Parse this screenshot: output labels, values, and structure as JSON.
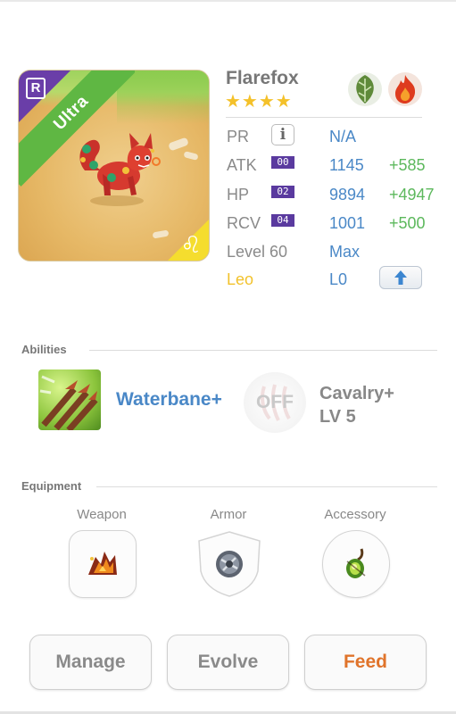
{
  "monster": {
    "name": "Flarefox",
    "stars": "★★★★",
    "rarity_letter": "R",
    "tier": "Ultra",
    "zodiac_glyph": "♌",
    "elements": [
      "leaf-element-icon",
      "fire-element-icon"
    ]
  },
  "stats": {
    "pr": {
      "label": "PR",
      "info": "i",
      "value": "N/A"
    },
    "atk": {
      "label": "ATK",
      "plus": "00",
      "value": "1145",
      "bonus": "+585"
    },
    "hp": {
      "label": "HP",
      "plus": "02",
      "value": "9894",
      "bonus": "+4947"
    },
    "rcv": {
      "label": "RCV",
      "plus": "04",
      "value": "1001",
      "bonus": "+500"
    },
    "level": {
      "label": "Level 60",
      "value": "Max"
    },
    "sign": {
      "label": "Leo",
      "value": "L0"
    }
  },
  "abilities": {
    "title": "Abilities",
    "skill_name": "Waterbane+",
    "leader_state": "OFF",
    "leader_name": "Cavalry+",
    "leader_level": "LV 5"
  },
  "equipment": {
    "title": "Equipment",
    "slots": [
      {
        "label": "Weapon",
        "icon": "weapon-icon"
      },
      {
        "label": "Armor",
        "icon": "armor-icon"
      },
      {
        "label": "Accessory",
        "icon": "accessory-icon"
      }
    ]
  },
  "actions": {
    "manage": "Manage",
    "evolve": "Evolve",
    "feed": "Feed"
  },
  "colors": {
    "accent_blue": "#4a88c7",
    "bonus_green": "#5cb85c",
    "ultra_green": "#5fb743",
    "rarity_purple": "#6a3ea8",
    "zodiac_yellow": "#f2c22c",
    "feed_orange": "#e0742b"
  }
}
